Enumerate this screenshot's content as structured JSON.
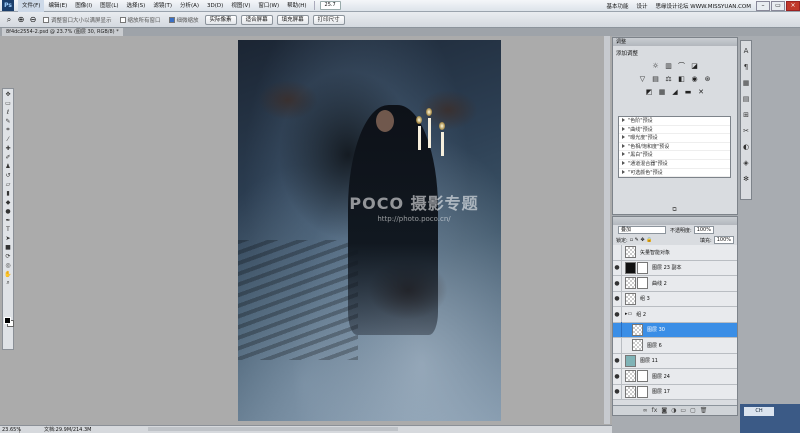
{
  "menubar": {
    "items": [
      "文件(F)",
      "编辑(E)",
      "图像(I)",
      "图层(L)",
      "选择(S)",
      "滤镜(T)",
      "分析(A)",
      "3D(D)",
      "视图(V)",
      "窗口(W)",
      "帮助(H)"
    ],
    "active_index": 0,
    "zoom_value": "25.7",
    "workspace": "基本功能",
    "design_label": "设计",
    "watermark_site": "思缘设计论坛 WWW.MISSYUAN.COM",
    "cslive_label": "CS Live"
  },
  "options": {
    "resize_windows": "调整窗口大小以满屏显示",
    "zoom_all": "缩放所有窗口",
    "scrubby_zoom": "细微缩放",
    "actual_pixels": "实际像素",
    "fit_screen": "适合屏幕",
    "fill_screen": "填充屏幕",
    "print_size": "打印尺寸"
  },
  "document": {
    "tab_title": "8f4dc2554-2.psd @ 23.7% (图层 30, RGB/8) *",
    "watermark_main": "POCO 摄影专题",
    "watermark_url": "http://photo.poco.cn/"
  },
  "status": {
    "zoom": "23.65%",
    "doc_size": "文档:29.9M/214.3M"
  },
  "adjustments": {
    "title": "调整",
    "subtitle": "添加调整",
    "presets": [
      "\"色阶\"预设",
      "\"曲线\"预设",
      "\"曝光度\"预设",
      "\"色相/饱和度\"预设",
      "\"黑白\"预设",
      "\"通道混合器\"预设",
      "\"可选颜色\"预设"
    ]
  },
  "layers": {
    "blend_mode": "叠加",
    "opacity_label": "不透明度:",
    "opacity_value": "100%",
    "lock_label": "锁定:",
    "fill_label": "填充:",
    "fill_value": "100%",
    "rows": [
      {
        "name": "矢量智能对象",
        "thumb": "trans",
        "selected": false,
        "eye": false
      },
      {
        "name": "图层 23 副本",
        "thumb": "dark",
        "selected": false,
        "eye": true
      },
      {
        "name": "曲线 2",
        "thumb": "trans",
        "selected": false,
        "eye": true
      },
      {
        "name": "组 3",
        "thumb": "trans",
        "selected": false,
        "eye": true
      },
      {
        "name": "组 2",
        "thumb": "folder",
        "selected": false,
        "eye": true
      },
      {
        "name": "图层 30",
        "thumb": "trans",
        "selected": true,
        "eye": false
      },
      {
        "name": "图层 6",
        "thumb": "trans",
        "selected": false,
        "eye": false
      },
      {
        "name": "图层 11",
        "thumb": "teal",
        "selected": false,
        "eye": true
      },
      {
        "name": "图层 24",
        "thumb": "trans",
        "selected": false,
        "eye": true
      },
      {
        "name": "图层 17",
        "thumb": "trans",
        "selected": false,
        "eye": true
      }
    ]
  },
  "taskbar": {
    "lang": "CH"
  }
}
